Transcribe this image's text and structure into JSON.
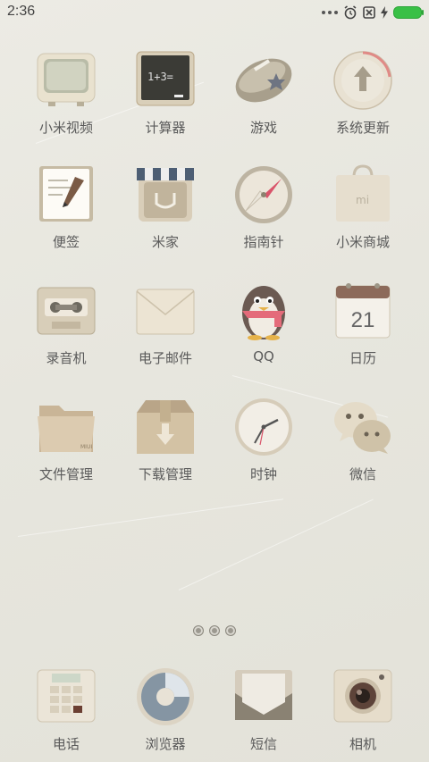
{
  "status_bar": {
    "time": "2:36",
    "battery_color": "#39c046"
  },
  "apps": [
    {
      "label": "小米视频",
      "icon": "tv-icon"
    },
    {
      "label": "计算器",
      "icon": "chalkboard-icon",
      "chalk_text": "1+3="
    },
    {
      "label": "游戏",
      "icon": "football-icon"
    },
    {
      "label": "系统更新",
      "icon": "update-arrow-icon"
    },
    {
      "label": "便签",
      "icon": "notepad-pencil-icon"
    },
    {
      "label": "米家",
      "icon": "store-icon"
    },
    {
      "label": "指南针",
      "icon": "compass-icon"
    },
    {
      "label": "小米商城",
      "icon": "shopping-bag-icon",
      "bag_text": "mi"
    },
    {
      "label": "录音机",
      "icon": "cassette-icon"
    },
    {
      "label": "电子邮件",
      "icon": "envelope-icon"
    },
    {
      "label": "QQ",
      "icon": "penguin-icon"
    },
    {
      "label": "日历",
      "icon": "calendar-icon",
      "day": "21"
    },
    {
      "label": "文件管理",
      "icon": "folder-icon",
      "folder_text": "MIUI"
    },
    {
      "label": "下载管理",
      "icon": "download-box-icon"
    },
    {
      "label": "时钟",
      "icon": "clock-icon"
    },
    {
      "label": "微信",
      "icon": "wechat-icon"
    }
  ],
  "dock": [
    {
      "label": "电话",
      "icon": "desk-phone-icon"
    },
    {
      "label": "浏览器",
      "icon": "browser-icon"
    },
    {
      "label": "短信",
      "icon": "message-envelope-icon"
    },
    {
      "label": "相机",
      "icon": "camera-icon"
    }
  ],
  "pages": {
    "count": 3,
    "active": 1
  }
}
